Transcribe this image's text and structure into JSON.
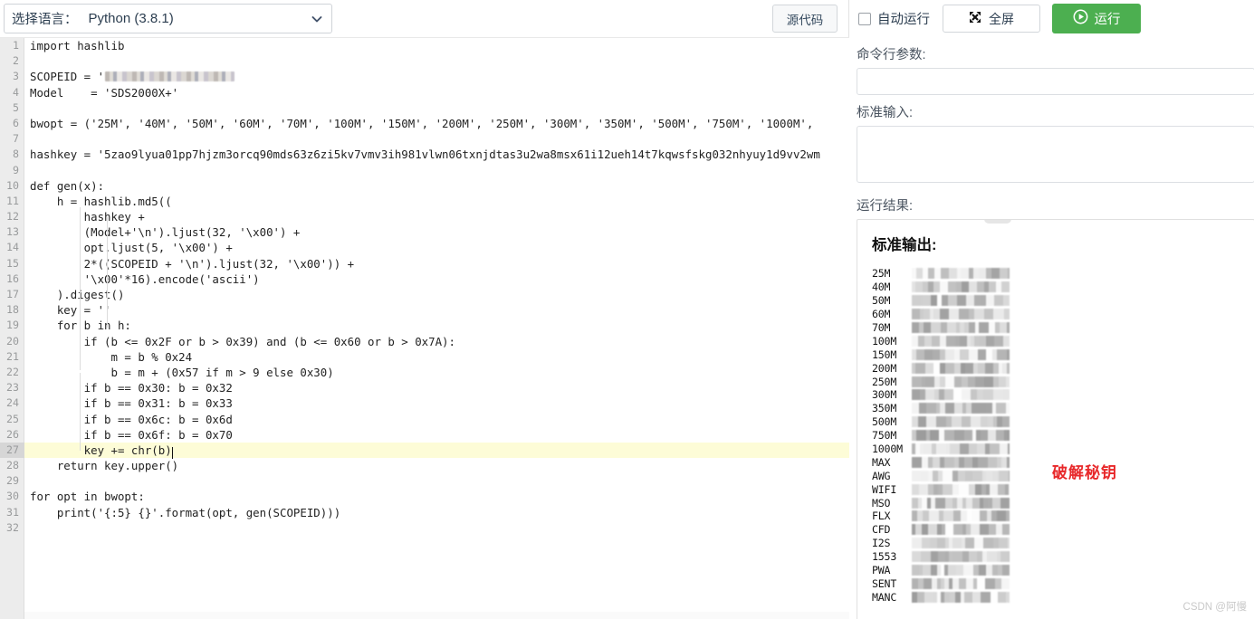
{
  "toolbar": {
    "language_label": "选择语言：",
    "language_value": "Python (3.8.1)",
    "chevron_icon": "chevron-down-icon",
    "source_code_label": "源代码",
    "autorun_label": "自动运行",
    "autorun_checked": false,
    "fullscreen_label": "全屏",
    "fullscreen_icon": "expand-arrows-icon",
    "run_label": "运行",
    "run_icon": "play-circle-icon",
    "run_color": "#4caf50"
  },
  "editor": {
    "total_lines": 32,
    "highlighted_line": 27,
    "lines": [
      {
        "n": "1",
        "text": "import hashlib"
      },
      {
        "n": "2",
        "text": ""
      },
      {
        "n": "3",
        "text": "SCOPEID = '",
        "redacted": true
      },
      {
        "n": "4",
        "text": "Model    = 'SDS2000X+'"
      },
      {
        "n": "5",
        "text": ""
      },
      {
        "n": "6",
        "text": "bwopt = ('25M', '40M', '50M', '60M', '70M', '100M', '150M', '200M', '250M', '300M', '350M', '500M', '750M', '1000M',"
      },
      {
        "n": "7",
        "text": ""
      },
      {
        "n": "8",
        "text": "hashkey = '5zao9lyua01pp7hjzm3orcq90mds63z6zi5kv7vmv3ih981vlwn06txnjdtas3u2wa8msx61i12ueh14t7kqwsfskg032nhyuy1d9vv2wm"
      },
      {
        "n": "9",
        "text": ""
      },
      {
        "n": "10",
        "text": "def gen(x):"
      },
      {
        "n": "11",
        "text": "    h = hashlib.md5(("
      },
      {
        "n": "12",
        "text": "        hashkey +"
      },
      {
        "n": "13",
        "text": "        (Model+'\\n').ljust(32, '\\x00') +"
      },
      {
        "n": "14",
        "text": "        opt.ljust(5, '\\x00') +"
      },
      {
        "n": "15",
        "text": "        2*((SCOPEID + '\\n').ljust(32, '\\x00')) +"
      },
      {
        "n": "16",
        "text": "        '\\x00'*16).encode('ascii')"
      },
      {
        "n": "17",
        "text": "    ).digest()"
      },
      {
        "n": "18",
        "text": "    key = ''"
      },
      {
        "n": "19",
        "text": "    for b in h:"
      },
      {
        "n": "20",
        "text": "        if (b <= 0x2F or b > 0x39) and (b <= 0x60 or b > 0x7A):"
      },
      {
        "n": "21",
        "text": "            m = b % 0x24"
      },
      {
        "n": "22",
        "text": "            b = m + (0x57 if m > 9 else 0x30)"
      },
      {
        "n": "23",
        "text": "        if b == 0x30: b = 0x32"
      },
      {
        "n": "24",
        "text": "        if b == 0x31: b = 0x33"
      },
      {
        "n": "25",
        "text": "        if b == 0x6c: b = 0x6d"
      },
      {
        "n": "26",
        "text": "        if b == 0x6f: b = 0x70"
      },
      {
        "n": "27",
        "text": "        key += chr(b)",
        "caret": true
      },
      {
        "n": "28",
        "text": "    return key.upper()"
      },
      {
        "n": "29",
        "text": ""
      },
      {
        "n": "30",
        "text": "for opt in bwopt:"
      },
      {
        "n": "31",
        "text": "    print('{:5} {}'.format(opt, gen(SCOPEID)))"
      },
      {
        "n": "32",
        "text": ""
      }
    ]
  },
  "right": {
    "cmdline_label": "命令行参数:",
    "cmdline_value": "",
    "cmdline_placeholder": "",
    "stdin_label": "标准输入:",
    "stdin_value": "",
    "stdin_placeholder": "",
    "result_label": "运行结果:",
    "stdout_title": "标准输出:",
    "output_rows": [
      {
        "key": "25M",
        "value_redacted": true
      },
      {
        "key": "40M",
        "value_redacted": true
      },
      {
        "key": "50M",
        "value_redacted": true
      },
      {
        "key": "60M",
        "value_redacted": true
      },
      {
        "key": "70M",
        "value_redacted": true
      },
      {
        "key": "100M",
        "value_redacted": true
      },
      {
        "key": "150M",
        "value_redacted": true
      },
      {
        "key": "200M",
        "value_redacted": true
      },
      {
        "key": "250M",
        "value_redacted": true
      },
      {
        "key": "300M",
        "value_redacted": true
      },
      {
        "key": "350M",
        "value_redacted": true
      },
      {
        "key": "500M",
        "value_redacted": true
      },
      {
        "key": "750M",
        "value_redacted": true
      },
      {
        "key": "1000M",
        "value_redacted": true
      },
      {
        "key": "MAX",
        "value_redacted": true
      },
      {
        "key": "AWG",
        "value_redacted": true
      },
      {
        "key": "WIFI",
        "value_redacted": true
      },
      {
        "key": "MSO",
        "value_redacted": true
      },
      {
        "key": "FLX",
        "value_redacted": true
      },
      {
        "key": "CFD",
        "value_redacted": true
      },
      {
        "key": "I2S",
        "value_redacted": true
      },
      {
        "key": "1553",
        "value_redacted": true
      },
      {
        "key": "PWA",
        "value_redacted": true
      },
      {
        "key": "SENT",
        "value_redacted": true
      },
      {
        "key": "MANC",
        "value_redacted": true
      }
    ],
    "annotation": "破解秘钥",
    "annotation_color": "#e8282a"
  },
  "watermark": "CSDN @阿慢"
}
